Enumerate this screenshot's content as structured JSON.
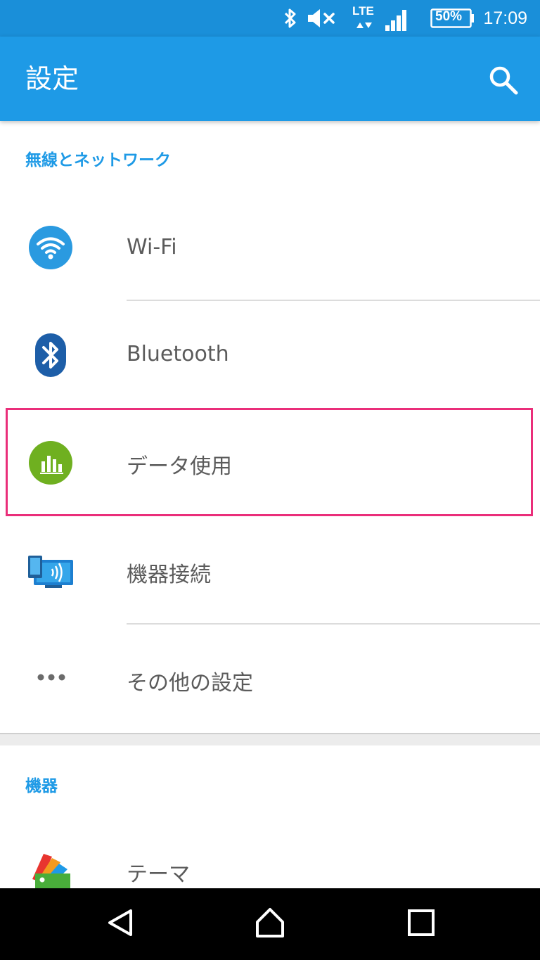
{
  "status_bar": {
    "time": "17:09",
    "battery": "50%",
    "network": "LTE",
    "icons": [
      "bluetooth-icon",
      "mute-icon",
      "lte-icon",
      "signal-icon",
      "battery-icon"
    ]
  },
  "app_bar": {
    "title": "設定",
    "search_icon": "search-icon"
  },
  "sections": [
    {
      "header": "無線とネットワーク",
      "items": [
        {
          "label": "Wi-Fi",
          "icon": "wifi-icon"
        },
        {
          "label": "Bluetooth",
          "icon": "bluetooth-icon"
        },
        {
          "label": "データ使用",
          "icon": "data-usage-icon",
          "highlighted": true
        },
        {
          "label": "機器接続",
          "icon": "device-connection-icon"
        },
        {
          "label": "その他の設定",
          "icon": "more-icon"
        }
      ]
    },
    {
      "header": "機器",
      "items": [
        {
          "label": "テーマ",
          "icon": "theme-icon"
        }
      ]
    }
  ],
  "nav_bar": {
    "buttons": [
      "back-icon",
      "home-icon",
      "recents-icon"
    ]
  },
  "colors": {
    "status_bar": "#1a8fd9",
    "app_bar": "#1e9ae6",
    "accent": "#1e9ae6",
    "highlight_border": "#ea2e7a",
    "text_primary": "#5b5b5b"
  }
}
